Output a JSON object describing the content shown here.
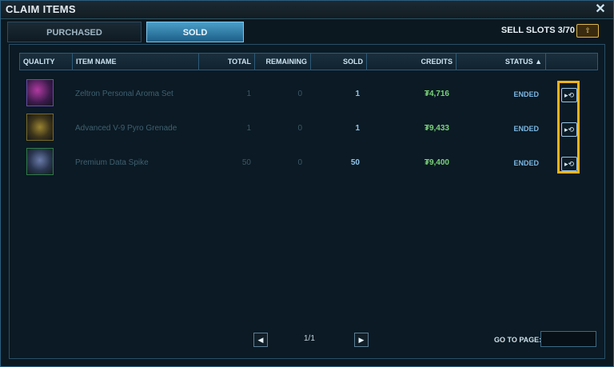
{
  "window": {
    "title": "CLAIM ITEMS",
    "close_label": "✕"
  },
  "tabs": [
    {
      "label": "PURCHASED"
    },
    {
      "label": "SOLD"
    }
  ],
  "sell_slots": {
    "label": "SELL SLOTS 3/70",
    "icon": "upgrade-slots-icon",
    "icon_glyph": "⇧"
  },
  "table": {
    "columns": [
      "QUALITY",
      "ITEM NAME",
      "TOTAL",
      "REMAINING",
      "SOLD",
      "CREDITS",
      "STATUS ▲"
    ],
    "rows": [
      {
        "item_name": "Zeltron Personal Aroma Set",
        "total": "1",
        "remaining": "0",
        "sold": "1",
        "credits": "₮4,716",
        "status": "ENDED",
        "quality_color": "#6a4aa8"
      },
      {
        "item_name": "Advanced V-9 Pyro Grenade",
        "total": "1",
        "remaining": "0",
        "sold": "1",
        "credits": "₮9,433",
        "status": "ENDED",
        "quality_color": "#7a6a26"
      },
      {
        "item_name": "Premium Data Spike",
        "total": "50",
        "remaining": "0",
        "sold": "50",
        "credits": "₮9,400",
        "status": "ENDED",
        "quality_color": "#2f7a46"
      }
    ],
    "claim_glyph": "▸⟲"
  },
  "pagination": {
    "prev": "◀",
    "next": "▶",
    "page_text": "1/1",
    "goto_label": "GO TO PAGE:",
    "goto_value": ""
  },
  "colors": {
    "accent": "#4a9ec8",
    "highlight": "#f0b41a",
    "credits": "#7ad37a"
  }
}
